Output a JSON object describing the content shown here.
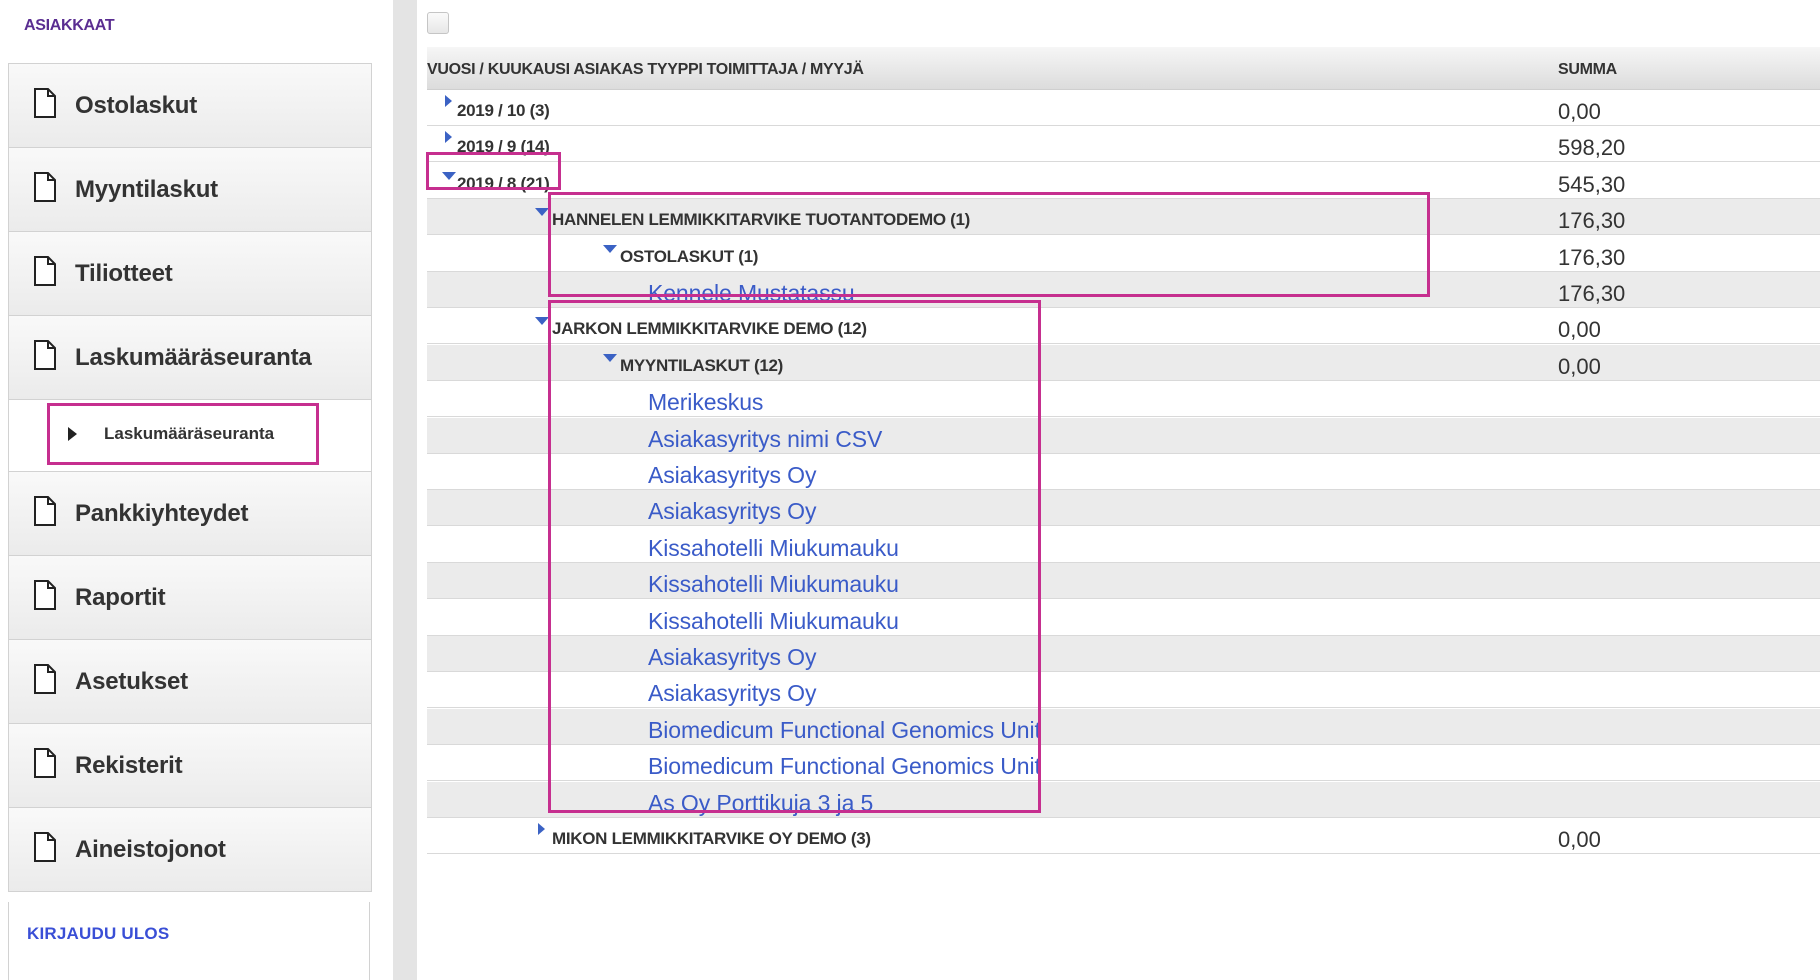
{
  "sidebar": {
    "title": "ASIAKKAAT",
    "items": [
      {
        "label": "Ostolaskut",
        "icon": "document-icon"
      },
      {
        "label": "Myyntilaskut",
        "icon": "document-icon"
      },
      {
        "label": "Tiliotteet",
        "icon": "document-icon"
      },
      {
        "label": "Laskumääräseuranta",
        "icon": "document-icon"
      },
      {
        "label": "Pankkiyhteydet",
        "icon": "document-icon"
      },
      {
        "label": "Raportit",
        "icon": "document-icon"
      },
      {
        "label": "Asetukset",
        "icon": "document-icon"
      },
      {
        "label": "Rekisterit",
        "icon": "document-icon"
      },
      {
        "label": "Aineistojonot",
        "icon": "document-icon"
      }
    ],
    "subitem": {
      "label": "Laskumääräseuranta",
      "icon": "triangle-right-icon"
    },
    "logout": "KIRJAUDU ULOS"
  },
  "table": {
    "columns": {
      "name": "VUOSI / KUUKAUSI ASIAKAS TYYPPI TOIMITTAJA / MYYJÄ",
      "sum": "SUMMA"
    },
    "rows": [
      {
        "level": 0,
        "kind": "group",
        "state": "collapsed",
        "label": "2019 / 10 (3)",
        "sum": "0,00"
      },
      {
        "level": 0,
        "kind": "group",
        "state": "collapsed",
        "label": "2019 / 9 (14)",
        "sum": "598,20"
      },
      {
        "level": 0,
        "kind": "group",
        "state": "expanded",
        "label": "2019 / 8 (21)",
        "sum": "545,30"
      },
      {
        "level": 1,
        "kind": "group",
        "state": "expanded",
        "label": "HANNELEN LEMMIKKITARVIKE TUOTANTODEMO (1)",
        "sum": "176,30"
      },
      {
        "level": 2,
        "kind": "group",
        "state": "expanded",
        "label": "OSTOLASKUT (1)",
        "sum": "176,30"
      },
      {
        "level": 3,
        "kind": "link",
        "label": "Kennele Mustatassu",
        "sum": "176,30"
      },
      {
        "level": 1,
        "kind": "group",
        "state": "expanded",
        "label": "JARKON LEMMIKKITARVIKE DEMO (12)",
        "sum": "0,00"
      },
      {
        "level": 2,
        "kind": "group",
        "state": "expanded",
        "label": "MYYNTILASKUT (12)",
        "sum": "0,00"
      },
      {
        "level": 3,
        "kind": "link",
        "label": "Merikeskus",
        "sum": ""
      },
      {
        "level": 3,
        "kind": "link",
        "label": "Asiakasyritys nimi CSV",
        "sum": ""
      },
      {
        "level": 3,
        "kind": "link",
        "label": "Asiakasyritys Oy",
        "sum": ""
      },
      {
        "level": 3,
        "kind": "link",
        "label": "Asiakasyritys Oy",
        "sum": ""
      },
      {
        "level": 3,
        "kind": "link",
        "label": "Kissahotelli Miukumauku",
        "sum": ""
      },
      {
        "level": 3,
        "kind": "link",
        "label": "Kissahotelli Miukumauku",
        "sum": ""
      },
      {
        "level": 3,
        "kind": "link",
        "label": "Kissahotelli Miukumauku",
        "sum": ""
      },
      {
        "level": 3,
        "kind": "link",
        "label": "Asiakasyritys Oy",
        "sum": ""
      },
      {
        "level": 3,
        "kind": "link",
        "label": "Asiakasyritys Oy",
        "sum": ""
      },
      {
        "level": 3,
        "kind": "link",
        "label": "Biomedicum Functional Genomics Unit",
        "sum": ""
      },
      {
        "level": 3,
        "kind": "link",
        "label": "Biomedicum Functional Genomics Unit",
        "sum": ""
      },
      {
        "level": 3,
        "kind": "link",
        "label": "As Oy Porttikuja 3 ja 5",
        "sum": ""
      },
      {
        "level": 1,
        "kind": "group",
        "state": "collapsed",
        "label": "MIKON LEMMIKKITARVIKE OY DEMO (3)",
        "sum": "0,00"
      }
    ]
  },
  "colors": {
    "highlight": "#c62f8f",
    "link": "#3a5bc8",
    "title": "#5a2d91",
    "logout": "#3a4fd6"
  }
}
